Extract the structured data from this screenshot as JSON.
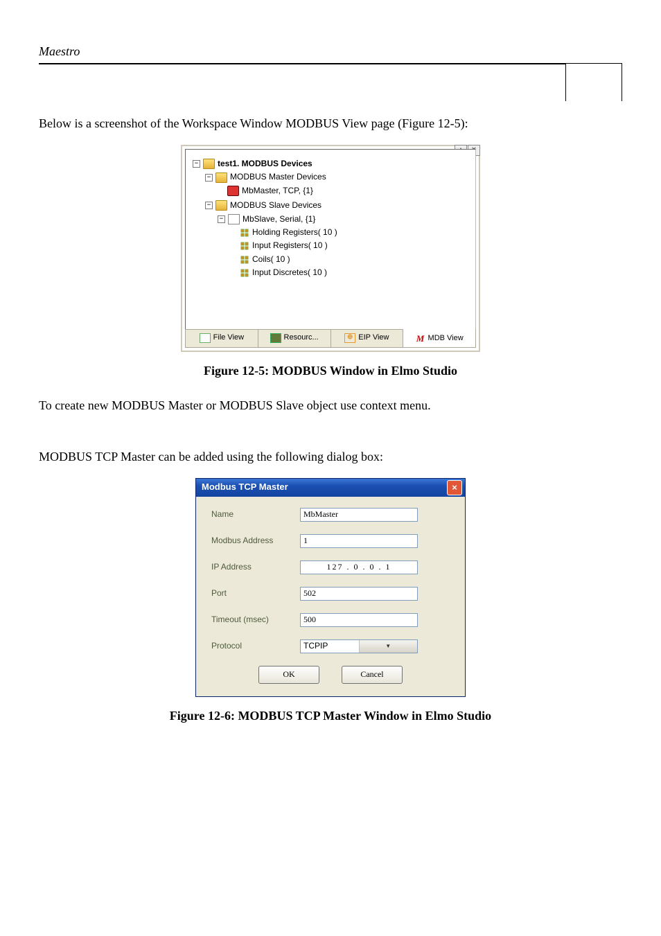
{
  "header": {
    "title": "Maestro"
  },
  "intro": "Below is a screenshot of the Workspace Window MODBUS View page (Figure 12-5):",
  "workspace": {
    "root": "test1. MODBUS Devices",
    "masterFolder": "MODBUS Master Devices",
    "masterItem": "MbMaster, TCP, {1}",
    "slaveFolder": "MODBUS Slave Devices",
    "slaveItem": "MbSlave, Serial, {1}",
    "leaves": {
      "holding": "Holding Registers( 10 )",
      "inputReg": "Input Registers( 10 )",
      "coils": "Coils( 10 )",
      "inputDisc": "Input Discretes( 10 )"
    },
    "tabs": {
      "file": "File View",
      "resourc": "Resourc...",
      "eip": "EIP View",
      "mdb": "MDB View"
    }
  },
  "caption1": "Figure 12-5: MODBUS Window in Elmo Studio",
  "para2": "To create new MODBUS Master or MODBUS Slave object use context menu.",
  "para3": "MODBUS TCP Master can be added using the following dialog box:",
  "dialog": {
    "title": "Modbus TCP Master",
    "labels": {
      "name": "Name",
      "addr": "Modbus Address",
      "ip": "IP Address",
      "port": "Port",
      "timeout": "Timeout (msec)",
      "proto": "Protocol"
    },
    "values": {
      "name": "MbMaster",
      "addr": "1",
      "ip": "127 . 0 . 0 . 1",
      "port": "502",
      "timeout": "500",
      "proto": "TCPIP"
    },
    "buttons": {
      "ok": "OK",
      "cancel": "Cancel"
    }
  },
  "caption2": "Figure 12-6: MODBUS TCP Master Window in Elmo Studio"
}
